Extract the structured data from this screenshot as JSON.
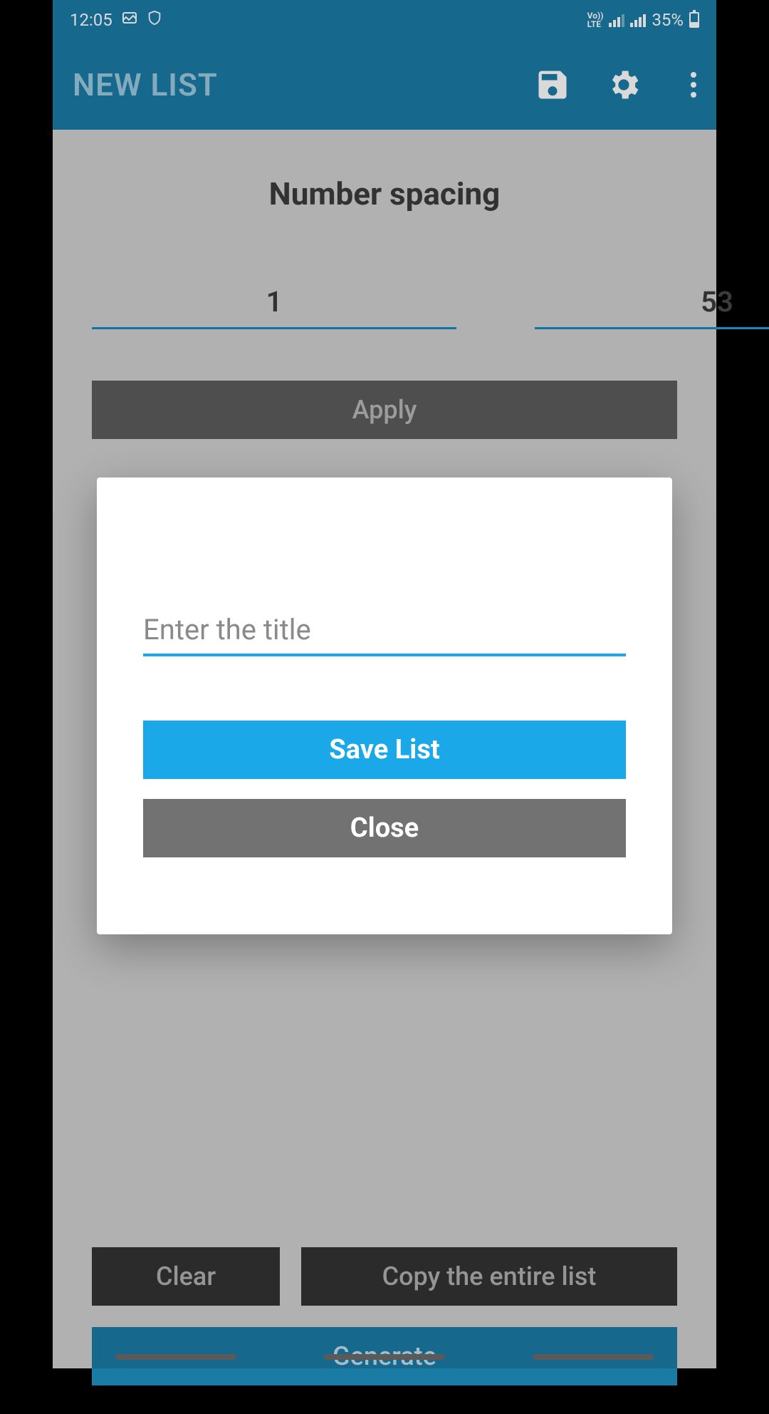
{
  "status_bar": {
    "time": "12:05",
    "battery_percent": "35%",
    "network_label": "Vo))\nLTE"
  },
  "app_bar": {
    "title": "NEW LIST"
  },
  "main": {
    "section_title": "Number spacing",
    "input_from": "1",
    "input_to": "53",
    "apply_label": "Apply",
    "clear_label": "Clear",
    "copy_label": "Copy the entire list",
    "generate_label": "Generate"
  },
  "dialog": {
    "title_placeholder": "Enter the title",
    "title_value": "",
    "save_label": "Save List",
    "close_label": "Close"
  }
}
